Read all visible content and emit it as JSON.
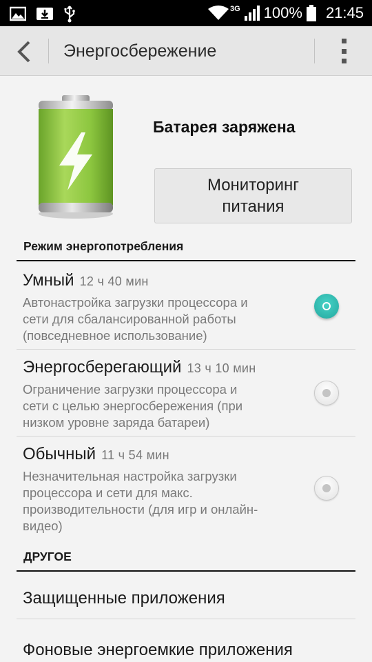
{
  "status_bar": {
    "battery_percent": "100%",
    "time": "21:45",
    "network_type": "3G",
    "icons": [
      "image-icon",
      "download-icon",
      "usb-icon",
      "wifi-icon",
      "signal-icon",
      "battery-full-icon"
    ]
  },
  "app_bar": {
    "title": "Энергосбережение",
    "icons": [
      "back-arrow-icon",
      "overflow-menu-icon"
    ]
  },
  "battery_card": {
    "status": "Батарея заряжена",
    "monitor_button_line1": "Мониторинг",
    "monitor_button_line2": "питания",
    "battery_icon": "battery-charging-icon"
  },
  "power_mode": {
    "header": "Режим энергопотребления",
    "options": [
      {
        "title": "Умный",
        "time": "12 ч 40 мин",
        "desc_lines": [
          "Автонастройка загрузки процессора и",
          "сети для сбалансированной работы",
          "(повседневное использование)"
        ],
        "selected": true
      },
      {
        "title": "Энергосберегающий",
        "time": "13 ч 10 мин",
        "desc_lines": [
          "Ограничение загрузки процессора и",
          "сети с целью энергосбережения (при",
          "низком уровне заряда батареи)"
        ],
        "selected": false
      },
      {
        "title": "Обычный",
        "time": "11 ч 54 мин",
        "desc_lines": [
          "Незначительная настройка загрузки",
          "процессора и сети для макс.",
          "производительности (для игр и онлайн-",
          "видео)"
        ],
        "selected": false
      }
    ]
  },
  "other": {
    "header": "ДРУГОЕ",
    "items": [
      "Защищенные приложения",
      "Фоновые энергоемкие приложения"
    ]
  },
  "colors": {
    "accent": "#2bb5aa",
    "battery_green": "#8cc63f",
    "status_bar": "#000000",
    "app_bar": "#e6e6e6"
  }
}
